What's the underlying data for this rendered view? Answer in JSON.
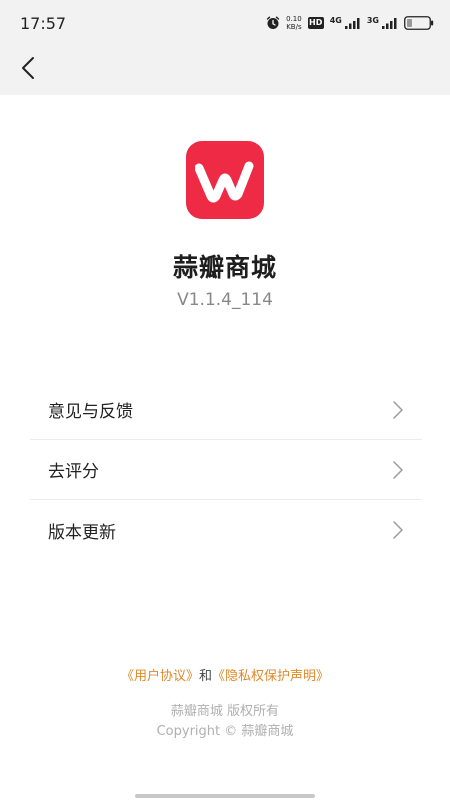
{
  "status_bar": {
    "time": "17:57",
    "net_speed_value": "0.10",
    "net_speed_unit": "KB/s",
    "hd_label": "HD",
    "net_4g": "4G",
    "net_3g": "3G"
  },
  "nav": {
    "back_icon": "chevron-left-icon"
  },
  "app": {
    "logo_color": "#ee2a45",
    "name": "蒜瓣商城",
    "version": "V1.1.4_114"
  },
  "menu": {
    "items": [
      {
        "label": "意见与反馈"
      },
      {
        "label": "去评分"
      },
      {
        "label": "版本更新"
      }
    ]
  },
  "footer": {
    "user_agreement": "《用户协议》",
    "conjunction": "和",
    "privacy_policy": "《隐私权保护声明》",
    "rights": "蒜瓣商城 版权所有",
    "copyright": "Copyright © 蒜瓣商城",
    "link_color": "#e0892b"
  }
}
